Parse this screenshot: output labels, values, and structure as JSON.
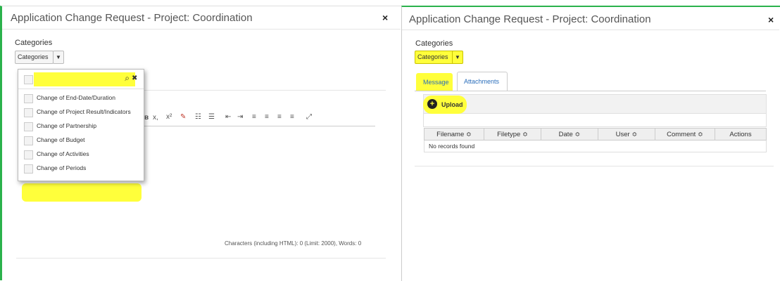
{
  "dialog_title": "Application Change Request - Project: Coordination",
  "close_glyph": "×",
  "categories_label": "Categories",
  "categories_button": "Categories",
  "dropdown": {
    "search_icon": "⌕",
    "clear_icon": "✖",
    "options": [
      "Change of End-Date/Duration",
      "Change of Project Result/Indicators",
      "Change of Partnership",
      "Change of Budget",
      "Change of Activities",
      "Change of Periods"
    ]
  },
  "editor": {
    "char_count": "Characters (including HTML): 0 (Limit: 2000), Words: 0"
  },
  "tabs": {
    "message": "Message",
    "attachments": "Attachments"
  },
  "upload_label": "Upload",
  "attachments_table": {
    "headers": [
      "Filename ≎",
      "Filetype ≎",
      "Date ≎",
      "User ≎",
      "Comment ≎",
      "Actions"
    ],
    "empty_text": "No records found"
  },
  "highlight_color": "#ffff3b",
  "frame_color": "#2bb24c"
}
